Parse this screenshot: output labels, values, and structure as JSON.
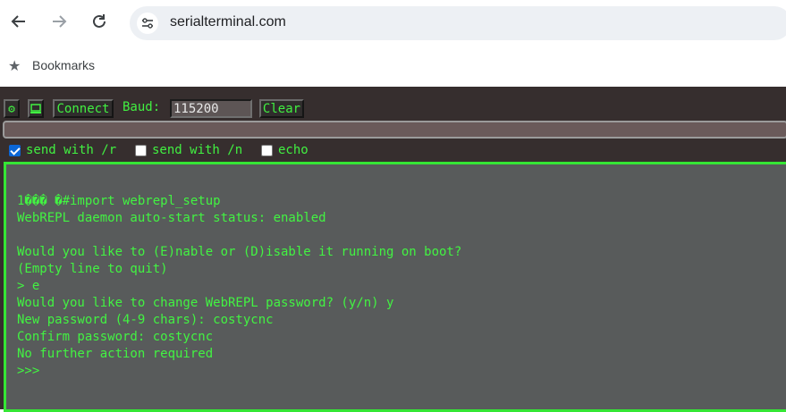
{
  "browser": {
    "url": "serialterminal.com",
    "bookmarks_label": "Bookmarks",
    "icons": [
      "back-arrow-icon",
      "forward-arrow-icon",
      "reload-icon",
      "site-settings-icon",
      "star-icon"
    ]
  },
  "toolbar": {
    "settings_icon": "⚙",
    "terminal_icon": "💻",
    "connect_label": "Connect",
    "baud_label": "Baud:",
    "baud_value": "115200",
    "clear_label": "Clear"
  },
  "send": {
    "value": ""
  },
  "options": [
    {
      "label": "send with /r",
      "checked": true
    },
    {
      "label": "send with /n",
      "checked": false
    },
    {
      "label": "echo",
      "checked": false
    }
  ],
  "terminal": {
    "lines": [
      "1��� �#import webrepl_setup",
      "WebREPL daemon auto-start status: enabled",
      "",
      "Would you like to (E)nable or (D)isable it running on boot?",
      "(Empty line to quit)",
      "> e",
      "Would you like to change WebREPL password? (y/n) y",
      "New password (4-9 chars): costycnc",
      "Confirm password: costycnc",
      "No further action required",
      ">>>"
    ]
  },
  "colors": {
    "terminal_text": "#42f342",
    "terminal_bg": "#585b5b",
    "page_bg": "#362e2e",
    "terminal_border": "#35e635"
  }
}
